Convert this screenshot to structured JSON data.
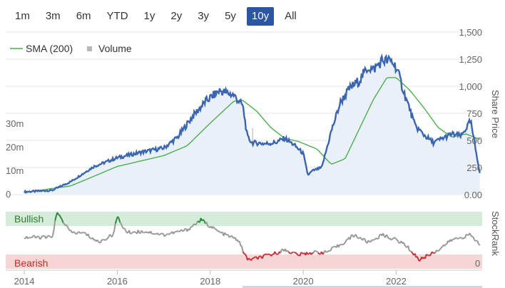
{
  "range_buttons": [
    {
      "label": "1m",
      "active": false
    },
    {
      "label": "3m",
      "active": false
    },
    {
      "label": "6m",
      "active": false
    },
    {
      "label": "YTD",
      "active": false
    },
    {
      "label": "1y",
      "active": false
    },
    {
      "label": "2y",
      "active": false
    },
    {
      "label": "3y",
      "active": false
    },
    {
      "label": "5y",
      "active": false
    },
    {
      "label": "10y",
      "active": true
    },
    {
      "label": "All",
      "active": false
    }
  ],
  "colors": {
    "price": "#3a66b0",
    "sma": "#4caf50",
    "volume": "#b8b8b8",
    "bullish_band": "#d4ecd9",
    "bearish_band": "#f6d5d5",
    "rank_neutral": "#999999",
    "rank_bull": "#2e8b3a",
    "rank_bear": "#c8303a",
    "active_button": "#2a56a5"
  },
  "chart_data": [
    {
      "type": "line",
      "ylabel": "Share Price",
      "y_ticks": [
        "1,500",
        "1,250",
        "1,000",
        "750",
        "500",
        "250",
        "0.00"
      ],
      "ylim": [
        0,
        1500
      ],
      "volume_ticks": [
        "30m",
        "20m",
        "10m",
        "0"
      ],
      "volume_ylim": [
        0,
        35
      ],
      "x_ticks": [
        "2014",
        "2016",
        "2018",
        "2020",
        "2022"
      ],
      "legend": [
        "SMA (200)",
        "Volume"
      ],
      "series": [
        {
          "name": "Share Price",
          "x": [
            2014.0,
            2014.6,
            2015.0,
            2015.5,
            2016.0,
            2016.5,
            2017.0,
            2017.3,
            2017.6,
            2017.9,
            2018.2,
            2018.5,
            2018.7,
            2018.8,
            2018.9,
            2019.2,
            2019.4,
            2019.6,
            2019.8,
            2020.0,
            2020.1,
            2020.2,
            2020.4,
            2020.6,
            2020.8,
            2021.0,
            2021.2,
            2021.4,
            2021.5,
            2021.7,
            2021.9,
            2022.0,
            2022.2,
            2022.3,
            2022.4,
            2022.6,
            2022.8,
            2023.0,
            2023.2,
            2023.4,
            2023.6,
            2023.8
          ],
          "y": [
            25,
            40,
            120,
            260,
            340,
            390,
            430,
            530,
            710,
            860,
            960,
            920,
            820,
            530,
            480,
            470,
            480,
            520,
            460,
            380,
            180,
            220,
            250,
            580,
            850,
            980,
            1050,
            1180,
            1150,
            1240,
            1230,
            1180,
            900,
            780,
            640,
            550,
            480,
            520,
            560,
            540,
            680,
            200
          ]
        },
        {
          "name": "SMA (200)",
          "x": [
            2014.0,
            2015.0,
            2016.0,
            2017.0,
            2017.5,
            2018.0,
            2018.5,
            2018.7,
            2019.0,
            2019.3,
            2019.6,
            2019.9,
            2020.3,
            2020.6,
            2020.9,
            2021.2,
            2021.5,
            2021.8,
            2022.0,
            2022.3,
            2022.6,
            2022.9,
            2023.2,
            2023.5,
            2023.8
          ],
          "y": [
            20,
            80,
            260,
            360,
            450,
            660,
            860,
            870,
            770,
            620,
            520,
            490,
            420,
            280,
            330,
            600,
            870,
            1080,
            1080,
            960,
            800,
            620,
            530,
            560,
            510
          ]
        },
        {
          "name": "Volume",
          "x": [
            2015.5,
            2016.0,
            2017.0,
            2018.3,
            2018.8,
            2018.9,
            2019.0,
            2019.5,
            2020.0,
            2020.3,
            2021.0,
            2021.5,
            2022.0,
            2022.5,
            2023.0,
            2023.5
          ],
          "y": [
            5,
            4,
            4,
            6,
            10,
            28,
            12,
            6,
            4,
            10,
            6,
            5,
            5,
            4,
            4,
            4
          ]
        }
      ]
    },
    {
      "type": "line",
      "ylabel": "StockRank",
      "y_ticks": [
        "0"
      ],
      "bands": [
        "Bullish",
        "Bearish"
      ],
      "series": [
        {
          "name": "StockRank",
          "x": [
            2014.0,
            2014.6,
            2014.7,
            2015.0,
            2015.3,
            2015.6,
            2015.9,
            2016.0,
            2016.2,
            2016.6,
            2017.0,
            2017.5,
            2017.8,
            2018.2,
            2018.6,
            2018.8,
            2019.0,
            2019.3,
            2019.6,
            2019.9,
            2020.2,
            2020.5,
            2020.8,
            2021.1,
            2021.4,
            2021.7,
            2022.0,
            2022.2,
            2022.5,
            2022.7,
            2022.9,
            2023.2,
            2023.6,
            2023.8
          ],
          "y": [
            50,
            50,
            100,
            60,
            58,
            40,
            55,
            90,
            60,
            62,
            55,
            65,
            85,
            60,
            45,
            5,
            8,
            15,
            25,
            15,
            20,
            20,
            35,
            55,
            40,
            55,
            45,
            35,
            5,
            15,
            25,
            45,
            55,
            35
          ]
        }
      ]
    }
  ]
}
